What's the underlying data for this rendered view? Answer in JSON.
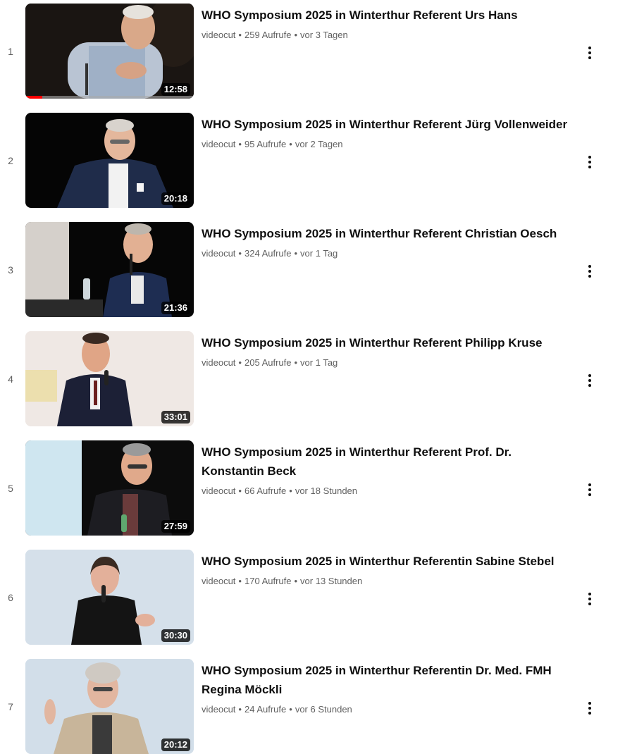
{
  "playlist": {
    "items": [
      {
        "index": "1",
        "title": "WHO Symposium 2025 in Winterthur Referent Urs Hans",
        "channel": "videocut",
        "views": "259 Aufrufe",
        "age": "vor 3 Tagen",
        "duration": "12:58",
        "watched_fraction": 0.1
      },
      {
        "index": "2",
        "title": "WHO Symposium 2025 in Winterthur Referent Jürg Vollenweider",
        "channel": "videocut",
        "views": "95 Aufrufe",
        "age": "vor 2 Tagen",
        "duration": "20:18"
      },
      {
        "index": "3",
        "title": "WHO Symposium 2025 in Winterthur Referent Christian Oesch",
        "channel": "videocut",
        "views": "324 Aufrufe",
        "age": "vor 1 Tag",
        "duration": "21:36"
      },
      {
        "index": "4",
        "title": "WHO Symposium 2025 in Winterthur Referent Philipp Kruse",
        "channel": "videocut",
        "views": "205 Aufrufe",
        "age": "vor 1 Tag",
        "duration": "33:01"
      },
      {
        "index": "5",
        "title": "WHO Symposium 2025 in Winterthur Referent Prof. Dr. Konstantin Beck",
        "channel": "videocut",
        "views": "66 Aufrufe",
        "age": "vor 18 Stunden",
        "duration": "27:59"
      },
      {
        "index": "6",
        "title": "WHO Symposium 2025 in Winterthur Referentin Sabine Stebel",
        "channel": "videocut",
        "views": "170 Aufrufe",
        "age": "vor 13 Stunden",
        "duration": "30:30"
      },
      {
        "index": "7",
        "title": "WHO Symposium 2025 in Winterthur Referentin Dr. Med. FMH Regina Möckli",
        "channel": "videocut",
        "views": "24 Aufrufe",
        "age": "vor 6 Stunden",
        "duration": "20:12"
      }
    ],
    "separator": "•",
    "menu_icon": "more-vert-icon",
    "colors": {
      "progress": "#ff0000",
      "meta_text": "#606060",
      "title_text": "#0f0f0f"
    }
  }
}
